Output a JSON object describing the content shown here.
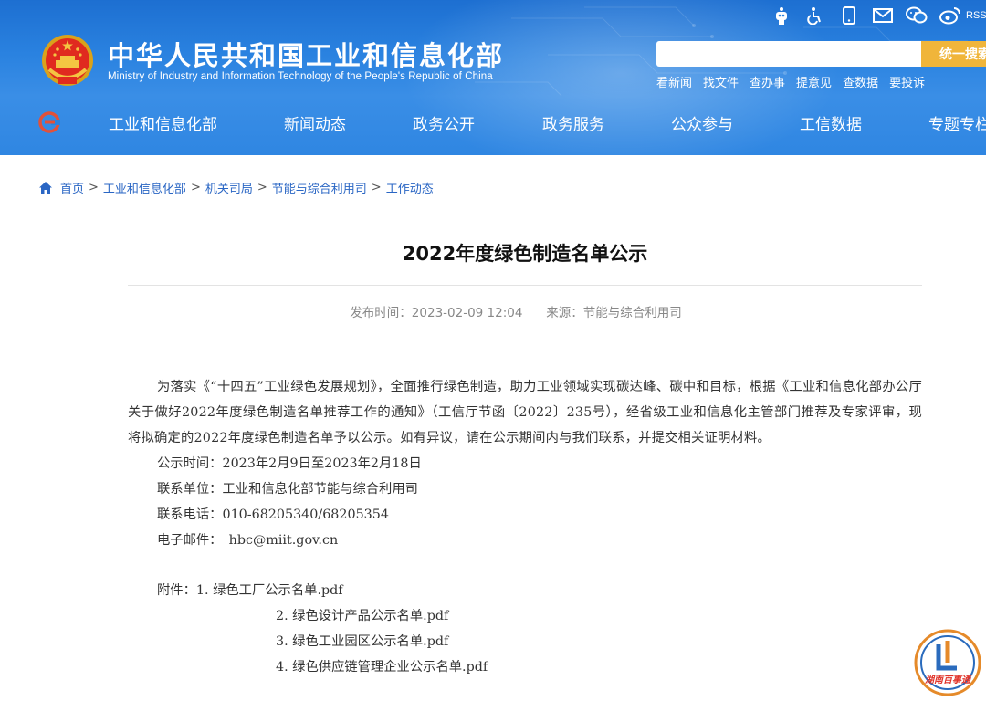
{
  "header": {
    "site_title": "中华人民共和国工业和信息化部",
    "site_subtitle": "Ministry of Industry and Information Technology of the People's Republic of China",
    "top_icons": [
      "robot-icon",
      "accessibility-icon",
      "mobile-icon",
      "mail-icon",
      "wechat-icon",
      "weibo-icon"
    ],
    "rss_label": "RSS",
    "search_placeholder": "",
    "search_button": "统一搜索",
    "quick_links": [
      "看新闻",
      "找文件",
      "查办事",
      "提意见",
      "查数据",
      "要投诉"
    ],
    "nav_items": [
      "工业和信息化部",
      "新闻动态",
      "政务公开",
      "政务服务",
      "公众参与",
      "工信数据",
      "专题专栏"
    ],
    "colors": {
      "header_blue": "#2a82e0",
      "search_button": "#f0b53a"
    }
  },
  "breadcrumb": [
    "首页",
    "工业和信息化部",
    "机关司局",
    "节能与综合利用司",
    "工作动态"
  ],
  "article": {
    "title": "2022年度绿色制造名单公示",
    "publish_label": "发布时间：",
    "publish_time": "2023-02-09 12:04",
    "source_label": "来源：",
    "source": "节能与综合利用司",
    "paragraph": "为落实《“十四五”工业绿色发展规划》，全面推行绿色制造，助力工业领域实现碳达峰、碳中和目标，根据《工业和信息化部办公厅关于做好2022年度绿色制造名单推荐工作的通知》（工信厅节函〔2022〕235号），经省级工业和信息化主管部门推荐及专家评审，现将拟确定的2022年度绿色制造名单予以公示。如有异议，请在公示期间内与我们联系，并提交相关证明材料。",
    "notice_period": "公示时间：2023年2月9日至2023年2月18日",
    "contact_unit": "联系单位：工业和信息化部节能与综合利用司",
    "contact_phone": "联系电话：010-68205340/68205354",
    "email": "电子邮件：　hbc@miit.gov.cn",
    "attachments_label": "附件：",
    "attachments": [
      "1. 绿色工厂公示名单.pdf",
      "2. 绿色设计产品公示名单.pdf",
      "3. 绿色工业园区公示名单.pdf",
      "4. 绿色供应链管理企业公示名单.pdf"
    ]
  },
  "watermark_text": "湖南百事通"
}
